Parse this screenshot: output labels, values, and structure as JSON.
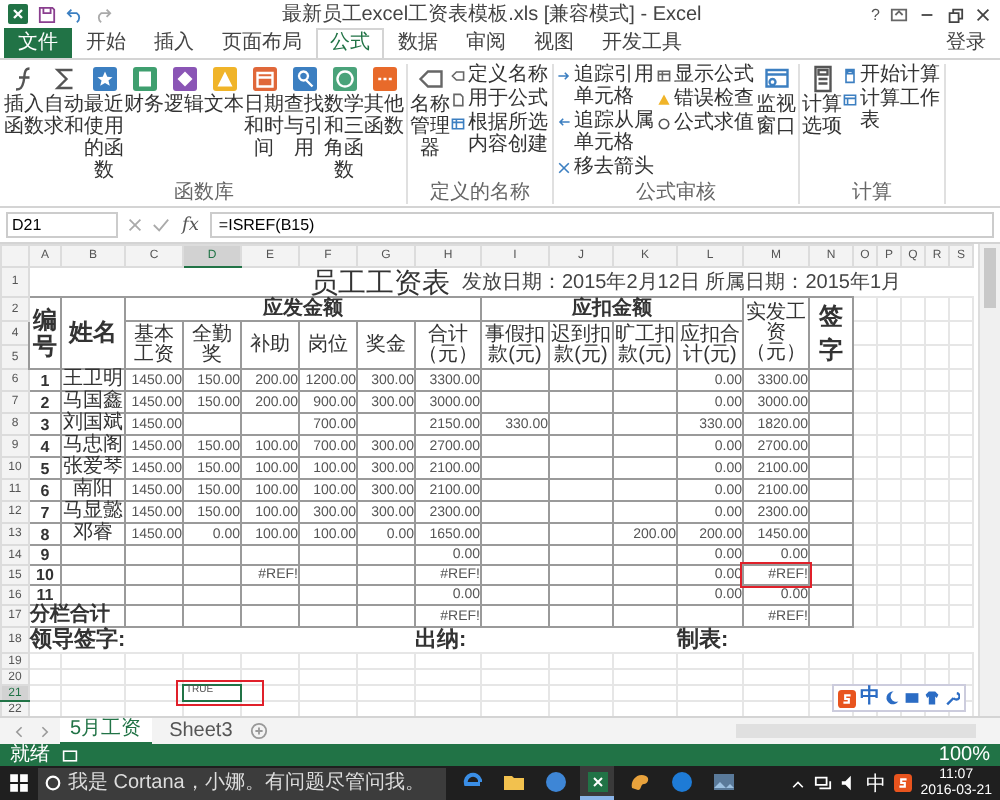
{
  "window": {
    "title": "最新员工excel工资表模板.xls [兼容模式] - Excel",
    "help": "?"
  },
  "ribbon_tabs": [
    {
      "label": "文件",
      "kind": "file",
      "selected": false
    },
    {
      "label": "开始",
      "kind": "tab",
      "selected": false
    },
    {
      "label": "插入",
      "kind": "tab",
      "selected": false
    },
    {
      "label": "页面布局",
      "kind": "tab",
      "selected": false
    },
    {
      "label": "公式",
      "kind": "tab",
      "selected": true
    },
    {
      "label": "数据",
      "kind": "tab",
      "selected": false
    },
    {
      "label": "审阅",
      "kind": "tab",
      "selected": false
    },
    {
      "label": "视图",
      "kind": "tab",
      "selected": false
    },
    {
      "label": "开发工具",
      "kind": "tab",
      "selected": false
    }
  ],
  "sign_in": "登录",
  "ribbon_groups": [
    {
      "label": "函数库",
      "items": [
        {
          "kind": "large",
          "label": "插入函数"
        },
        {
          "kind": "large",
          "label": "自动求和"
        },
        {
          "kind": "large",
          "label": "最近使用的函数"
        },
        {
          "kind": "large",
          "label": "财务"
        },
        {
          "kind": "large",
          "label": "逻辑"
        },
        {
          "kind": "large",
          "label": "文本"
        },
        {
          "kind": "large",
          "label": "日期和时间"
        },
        {
          "kind": "large",
          "label": "查找与引用"
        },
        {
          "kind": "large",
          "label": "数学和三角函数"
        },
        {
          "kind": "large",
          "label": "其他函数"
        }
      ]
    },
    {
      "label": "定义的名称",
      "items": [
        {
          "kind": "large",
          "label": "名称管理器"
        },
        {
          "kind": "small",
          "label": "定义名称"
        },
        {
          "kind": "small",
          "label": "用于公式"
        },
        {
          "kind": "small",
          "label": "根据所选内容创建"
        }
      ]
    },
    {
      "label": "公式审核",
      "items": [
        {
          "kind": "small",
          "label": "追踪引用单元格"
        },
        {
          "kind": "small",
          "label": "追踪从属单元格"
        },
        {
          "kind": "small",
          "label": "移去箭头"
        },
        {
          "kind": "small",
          "label": "显示公式"
        },
        {
          "kind": "small",
          "label": "错误检查"
        },
        {
          "kind": "small",
          "label": "公式求值"
        },
        {
          "kind": "large",
          "label": "监视窗口"
        }
      ]
    },
    {
      "label": "计算",
      "items": [
        {
          "kind": "large",
          "label": "计算选项"
        },
        {
          "kind": "small",
          "label": "开始计算"
        },
        {
          "kind": "small",
          "label": "计算工作表"
        }
      ]
    }
  ],
  "formula_bar": {
    "name_box": "D21",
    "fx": "fx",
    "formula": "=ISREF(B15)"
  },
  "sheet": {
    "columns": [
      {
        "label": "A",
        "selected": false
      },
      {
        "label": "B",
        "selected": false
      },
      {
        "label": "C",
        "selected": false
      },
      {
        "label": "D",
        "selected": true
      },
      {
        "label": "E",
        "selected": false
      },
      {
        "label": "F",
        "selected": false
      },
      {
        "label": "G",
        "selected": false
      },
      {
        "label": "H",
        "selected": false
      },
      {
        "label": "I",
        "selected": false
      },
      {
        "label": "J",
        "selected": false
      },
      {
        "label": "K",
        "selected": false
      },
      {
        "label": "L",
        "selected": false
      },
      {
        "label": "M",
        "selected": false
      },
      {
        "label": "N",
        "selected": false
      },
      {
        "label": "O",
        "selected": false
      },
      {
        "label": "P",
        "selected": false
      },
      {
        "label": "Q",
        "selected": false
      },
      {
        "label": "R",
        "selected": false
      },
      {
        "label": "S",
        "selected": false
      }
    ],
    "header_rows": [
      {
        "label": "1",
        "selected": false
      },
      {
        "label": "2",
        "selected": false
      },
      {
        "label": "4",
        "selected": false
      },
      {
        "label": "5",
        "selected": false
      }
    ],
    "title": "员工工资表",
    "date_note": "发放日期：2015年2月12日 所属日期：2015年1月",
    "header": {
      "number": "编号",
      "name": "姓名",
      "earn_group": "应发金额",
      "earn_columns": [
        "基本工资",
        "全勤奖",
        "补助",
        "岗位",
        "奖金",
        "合计（元）"
      ],
      "deduct_group": "应扣金额",
      "deduct_columns": [
        "事假扣款(元)",
        "迟到扣款(元)",
        "旷工扣款(元)",
        "应扣合计(元)"
      ],
      "net": "实发工资（元）",
      "sign": "签字"
    },
    "rows": [
      {
        "label": "6",
        "selected": false,
        "cells": [
          "1",
          "王卫明",
          "1450.00",
          "150.00",
          "200.00",
          "1200.00",
          "300.00",
          "3300.00",
          "",
          "",
          "",
          "0.00",
          "3300.00"
        ]
      },
      {
        "label": "7",
        "selected": false,
        "cells": [
          "2",
          "马国鑫",
          "1450.00",
          "150.00",
          "200.00",
          "900.00",
          "300.00",
          "3000.00",
          "",
          "",
          "",
          "0.00",
          "3000.00"
        ]
      },
      {
        "label": "8",
        "selected": false,
        "cells": [
          "3",
          "刘国斌",
          "1450.00",
          "",
          "",
          "700.00",
          "",
          "2150.00",
          "330.00",
          "",
          "",
          "330.00",
          "1820.00"
        ]
      },
      {
        "label": "9",
        "selected": false,
        "cells": [
          "4",
          "马忠阁",
          "1450.00",
          "150.00",
          "100.00",
          "700.00",
          "300.00",
          "2700.00",
          "",
          "",
          "",
          "0.00",
          "2700.00"
        ]
      },
      {
        "label": "10",
        "selected": false,
        "cells": [
          "5",
          "张爱琴",
          "1450.00",
          "150.00",
          "100.00",
          "100.00",
          "300.00",
          "2100.00",
          "",
          "",
          "",
          "0.00",
          "2100.00"
        ]
      },
      {
        "label": "11",
        "selected": false,
        "cells": [
          "6",
          "南阳",
          "1450.00",
          "150.00",
          "100.00",
          "100.00",
          "300.00",
          "2100.00",
          "",
          "",
          "",
          "0.00",
          "2100.00"
        ]
      },
      {
        "label": "12",
        "selected": false,
        "cells": [
          "7",
          "马显懿",
          "1450.00",
          "150.00",
          "100.00",
          "300.00",
          "300.00",
          "2300.00",
          "",
          "",
          "",
          "0.00",
          "2300.00"
        ]
      },
      {
        "label": "13",
        "selected": false,
        "cells": [
          "8",
          "邓睿",
          "1450.00",
          "0.00",
          "100.00",
          "100.00",
          "0.00",
          "1650.00",
          "",
          "",
          "200.00",
          "200.00",
          "1450.00"
        ]
      },
      {
        "label": "14",
        "selected": false,
        "cells": [
          "9",
          "",
          "",
          "",
          "",
          "",
          "",
          "0.00",
          "",
          "",
          "",
          "0.00",
          "0.00"
        ]
      },
      {
        "label": "15",
        "selected": false,
        "cells": [
          "10",
          "",
          "",
          "",
          "#REF!",
          "",
          "",
          "#REF!",
          "",
          "",
          "",
          "0.00",
          {
            "text": "#REF!",
            "marked": true
          }
        ]
      },
      {
        "label": "16",
        "selected": false,
        "cells": [
          "11",
          "",
          "",
          "",
          "",
          "",
          "",
          "0.00",
          "",
          "",
          "",
          "0.00",
          "0.00"
        ]
      }
    ],
    "total_row": {
      "label": "17",
      "selected": false,
      "title": "分栏合计",
      "cells": [
        "",
        "",
        "",
        "",
        "",
        "#REF!",
        "",
        "",
        "",
        "",
        "#REF!"
      ]
    },
    "signature_row": {
      "label": "18",
      "selected": false,
      "items": [
        "领导签字:",
        "出纳:",
        "制表:"
      ]
    },
    "empty_rows": [
      {
        "label": "19",
        "selected": false
      },
      {
        "label": "20",
        "selected": false
      },
      {
        "label": "21",
        "selected": true,
        "active_value": {
          "text": "TRUE",
          "marked": true
        }
      },
      {
        "label": "22",
        "selected": false
      }
    ]
  },
  "sheet_tabs": [
    {
      "label": "5月工资",
      "selected": true
    },
    {
      "label": "Sheet3",
      "selected": false
    }
  ],
  "status_bar": {
    "ready": "就绪",
    "zoom": "100%"
  },
  "ime_toolbar": {
    "mode": "中"
  },
  "taskbar": {
    "placeholder": "我是 Cortana，小娜。有问题尽管问我。",
    "apps": [
      {
        "selected": false
      },
      {
        "selected": false
      },
      {
        "selected": false
      },
      {
        "selected": true
      },
      {
        "selected": false
      },
      {
        "selected": false
      },
      {
        "selected": false
      }
    ],
    "ime": "中",
    "time": "11:07",
    "date": "2016-03-21"
  }
}
